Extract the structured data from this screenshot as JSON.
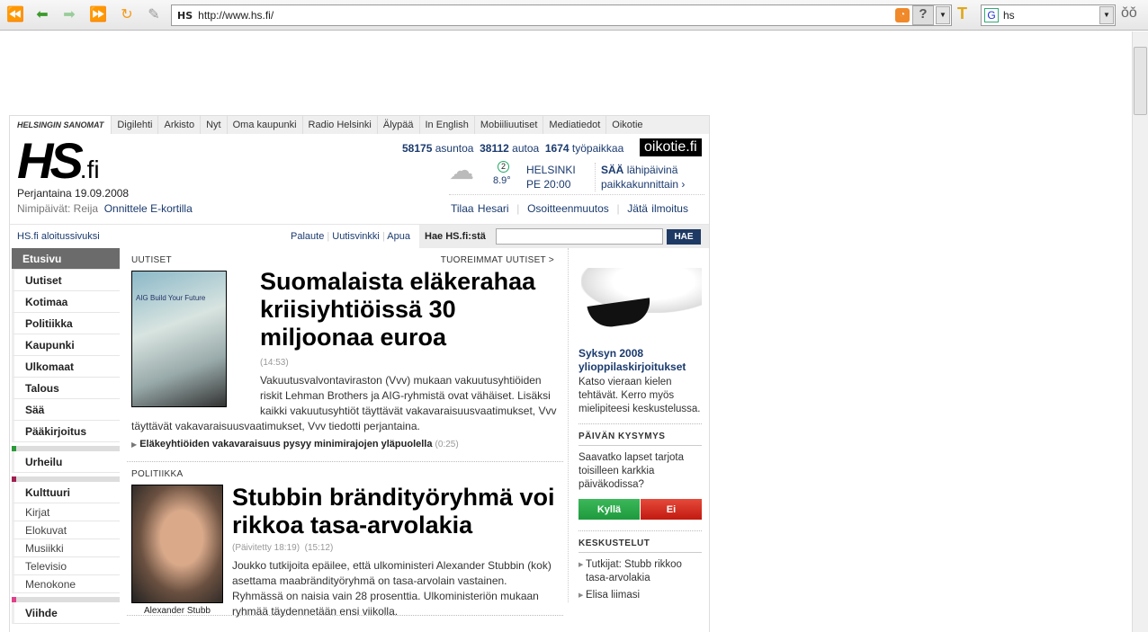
{
  "browser": {
    "site_badge": "HS",
    "url": "http://www.hs.fi/",
    "search_value": "hs"
  },
  "topnav": [
    "HELSINGIN SANOMAT",
    "Digilehti",
    "Arkisto",
    "Nyt",
    "Oma kaupunki",
    "Radio Helsinki",
    "Älypää",
    "In English",
    "Mobiiliuutiset",
    "Mediatiedot",
    "Oikotie"
  ],
  "header": {
    "logo": "HS",
    "logo_suffix": ".fi",
    "date": "Perjantaina 19.09.2008",
    "nameday_label": "Nimipäivät: Reija",
    "ecard": "Onnittele E-kortilla",
    "stats": [
      {
        "n": "58175",
        "t": "asuntoa"
      },
      {
        "n": "38112",
        "t": "autoa"
      },
      {
        "n": "1674",
        "t": "työpaikkaa"
      }
    ],
    "oikotie": "oikotie.fi",
    "weather": {
      "wind": "2",
      "temp": "8.9°",
      "city": "HELSINKI",
      "time": "PE  20:00",
      "saa_bold": "SÄÄ",
      "saa_rest": "lähipäivinä",
      "saa_link": "paikkakunnittain ›"
    },
    "links": [
      "Tilaa Hesari",
      "Osoitteenmuutos",
      "Jätä ilmoitus"
    ]
  },
  "bar": {
    "home": "HS.fi aloitussivuksi",
    "links": [
      "Palaute",
      "Uutisvinkki",
      "Apua"
    ],
    "search_label": "Hae HS.fi:stä",
    "search_button": "HAE"
  },
  "sidebar": {
    "items": [
      "Etusivu",
      "Uutiset",
      "Kotimaa",
      "Politiikka",
      "Kaupunki",
      "Ulkomaat",
      "Talous",
      "Sää",
      "Pääkirjoitus"
    ],
    "urheilu": "Urheilu",
    "kulttuuri": "Kulttuuri",
    "kult_sub": [
      "Kirjat",
      "Elokuvat",
      "Musiikki",
      "Televisio",
      "Menokone"
    ],
    "viihde": "Viihde"
  },
  "news1": {
    "section": "UUTISET",
    "more": "TUOREIMMAT UUTISET >",
    "title": "Suomalaista eläkerahaa kriisiyhtiöissä 30 miljoonaa euroa",
    "time": "(14:53)",
    "body": "Vakuutusvalvontaviraston (Vvv) mukaan vakuutusyhtiöiden riskit Lehman Brothers ja AIG-ryhmistä ovat vähäiset. Lisäksi kaikki vakuutusyhtiöt täyttävät vakavaraisuusvaatimukset, Vvv tiedotti perjantaina.",
    "related": "Eläkeyhtiöiden vakavaraisuus pysyy minimirajojen yläpuolella",
    "related_time": "(0:25)",
    "image_text": "AIG Build Your Future"
  },
  "news2": {
    "section": "POLITIIKKA",
    "title": "Stubbin brändityöryhmä voi rikkoa tasa-arvolakia",
    "updated": "(Päivitetty 18:19)",
    "time": "(15:12)",
    "body": "Joukko tutkijoita epäilee, että ulkoministeri Alexander Stubbin (kok) asettama maabrändityöryhmä on tasa-arvolain vastainen. Ryhmässä on naisia vain 28 prosenttia. Ulkoministeriön mukaan ryhmää täydennetään ensi viikolla.",
    "caption": "Alexander Stubb"
  },
  "right": {
    "promo_title": "Syksyn 2008 ylioppilaskirjoitukset",
    "promo_text": "Katso vieraan kielen tehtävät. Kerro myös mielipiteesi keskustelussa.",
    "poll_head": "PÄIVÄN KYSYMYS",
    "poll_q": "Saavatko lapset tarjota toisilleen karkkia päiväkodissa?",
    "yes": "Kyllä",
    "no": "Ei",
    "disc_head": "KESKUSTELUT",
    "disc": [
      "Tutkijat: Stubb rikkoo tasa-arvolakia",
      "Elisa liimasi"
    ]
  }
}
